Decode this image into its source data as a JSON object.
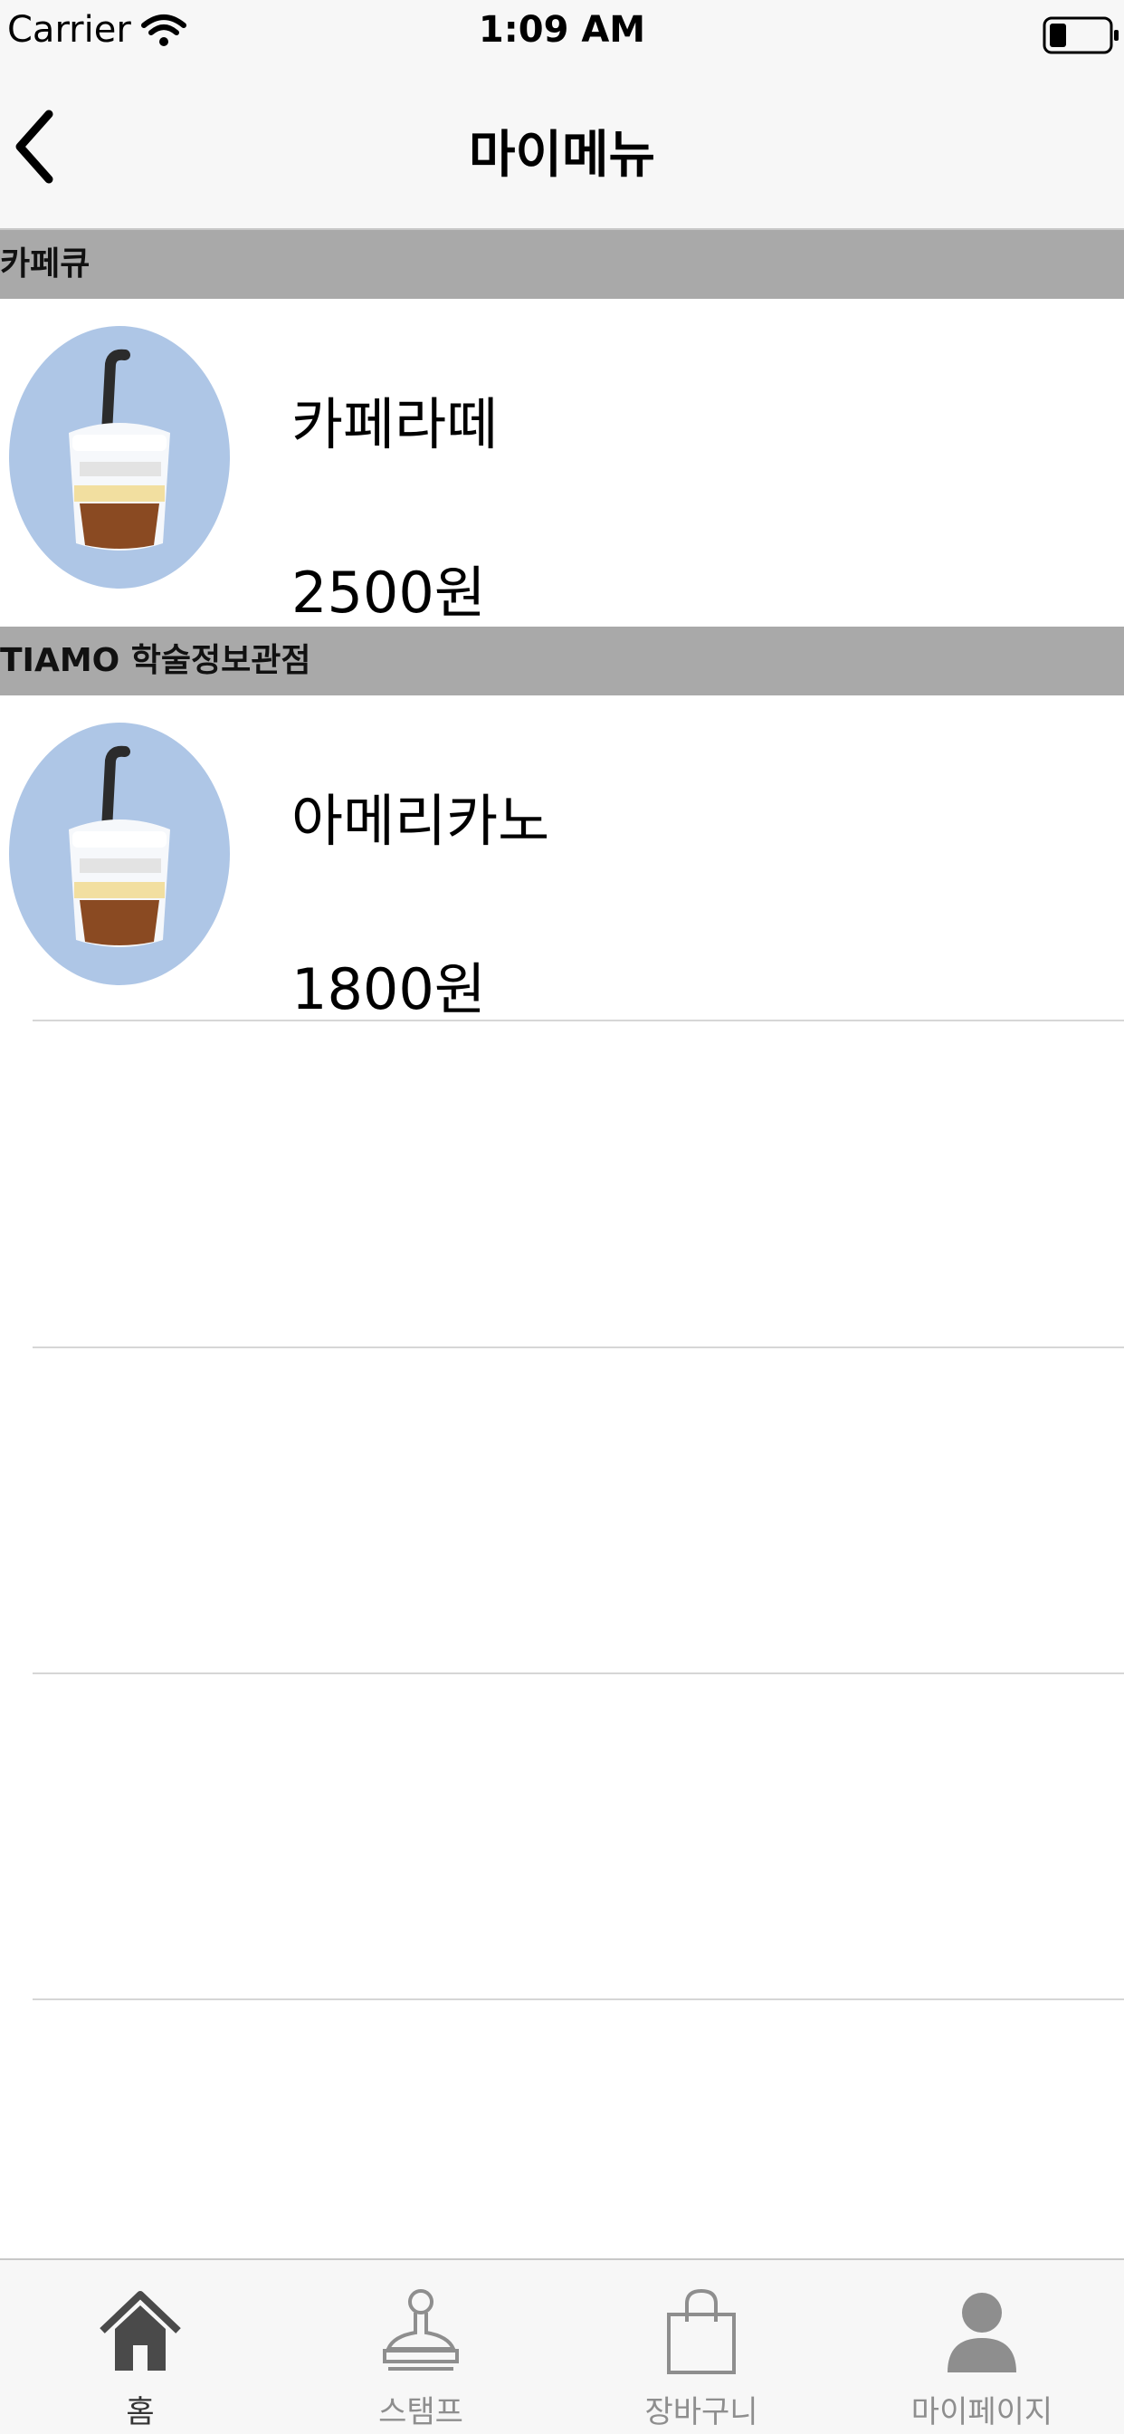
{
  "status_bar": {
    "carrier": "Carrier",
    "time": "1:09 AM"
  },
  "nav": {
    "title": "마이메뉴"
  },
  "sections": [
    {
      "header": "카페큐",
      "item": {
        "name": "카페라떼",
        "price": "2500원",
        "icon": "coffee-cup-icon"
      }
    },
    {
      "header": "TIAMO 학술정보관점",
      "item": {
        "name": "아메리카노",
        "price": "1800원",
        "icon": "coffee-cup-icon"
      }
    }
  ],
  "tabs": [
    {
      "label": "홈",
      "icon": "home-icon",
      "active": true
    },
    {
      "label": "스탬프",
      "icon": "stamp-icon",
      "active": false
    },
    {
      "label": "장바구니",
      "icon": "shopping-bag-icon",
      "active": false
    },
    {
      "label": "마이페이지",
      "icon": "person-icon",
      "active": false
    }
  ],
  "colors": {
    "thumb_bg": "#aec6e6",
    "section_bg": "#a9a9a9",
    "bar_bg": "#f7f7f7"
  }
}
